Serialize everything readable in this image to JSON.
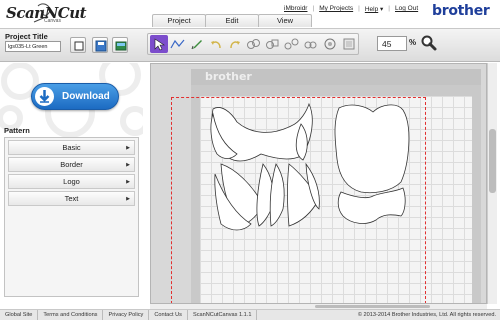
{
  "app": {
    "logo_text": "ScanNCut",
    "logo_sub": "Canvas",
    "brand": "brother"
  },
  "menu": {
    "tabs": [
      {
        "label": "Project"
      },
      {
        "label": "Edit"
      },
      {
        "label": "View"
      }
    ]
  },
  "topnav": {
    "user": "iMbroidr",
    "my_projects": "My Projects",
    "help": "Help",
    "help_arrow": "▾",
    "logout": "Log Out",
    "separator": "|"
  },
  "toolbar": {
    "project_title_label": "Project Title",
    "project_title_value": "lgs035-Lt Green",
    "zoom_value": "45",
    "zoom_unit": "%",
    "icons": [
      "new-project-icon",
      "save-icon",
      "import-icon",
      "select-icon",
      "line-icon",
      "pen-icon",
      "undo-icon",
      "redo-icon",
      "weld-icon",
      "group-icon",
      "ungroup-icon",
      "copy-icon",
      "target-icon",
      "scan-icon",
      "zoom-icon"
    ],
    "accent": "#7c4dcc"
  },
  "left": {
    "download_label": "Download",
    "pattern_title": "Pattern",
    "pattern_items": [
      {
        "label": "Basic",
        "arrow": "▶"
      },
      {
        "label": "Border",
        "arrow": "▶"
      },
      {
        "label": "Logo",
        "arrow": "▶"
      },
      {
        "label": "Text",
        "arrow": "▶"
      }
    ],
    "download_color": "#1c6bc2"
  },
  "canvas": {
    "mat_logo": "brother"
  },
  "footer": {
    "links": [
      {
        "label": "Global Site"
      },
      {
        "label": "Terms and Conditions"
      },
      {
        "label": "Privacy Policy"
      },
      {
        "label": "Contact Us"
      },
      {
        "label": "ScanNCutCanvas 1.1.1"
      }
    ],
    "copyright": "© 2013-2014 Brother Industries, Ltd. All rights reserved."
  }
}
